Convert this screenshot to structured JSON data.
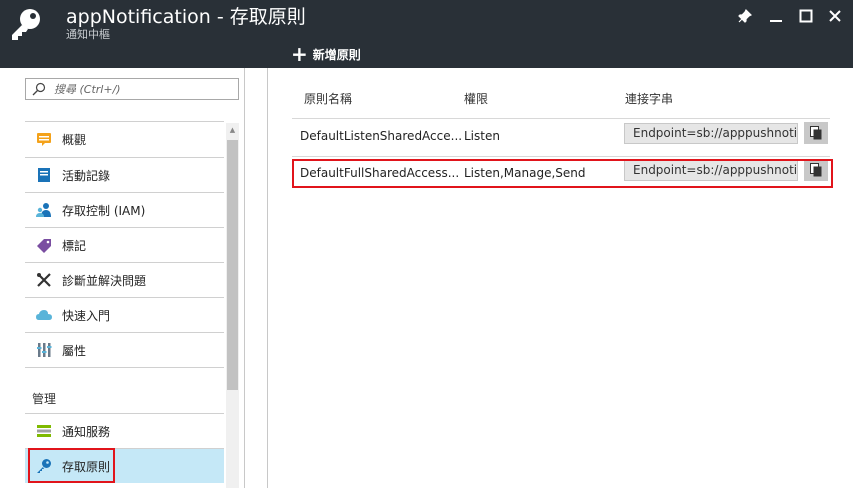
{
  "window": {
    "title": "appNotification - 存取原則",
    "subtitle": "通知中樞"
  },
  "toolbar": {
    "add_label": "新增原則"
  },
  "search": {
    "placeholder": "搜尋 (Ctrl+/)"
  },
  "nav": {
    "items": [
      {
        "label": "概觀",
        "icon": "overview-icon"
      },
      {
        "label": "活動記錄",
        "icon": "activity-log-icon"
      },
      {
        "label": "存取控制 (IAM)",
        "icon": "iam-icon"
      },
      {
        "label": "標記",
        "icon": "tag-icon"
      },
      {
        "label": "診斷並解決問題",
        "icon": "wrench-icon"
      },
      {
        "label": "快速入門",
        "icon": "cloud-icon"
      },
      {
        "label": "屬性",
        "icon": "properties-icon"
      }
    ],
    "section": "管理",
    "manage_items": [
      {
        "label": "通知服務",
        "icon": "notification-services-icon"
      },
      {
        "label": "存取原則",
        "icon": "key-icon",
        "active": true
      }
    ]
  },
  "table": {
    "headers": [
      "原則名稱",
      "權限",
      "連接字串"
    ],
    "rows": [
      {
        "name": "DefaultListenSharedAcce...",
        "permissions": "Listen",
        "connection": "Endpoint=sb://apppushnoti"
      },
      {
        "name": "DefaultFullSharedAccess...",
        "permissions": "Listen,Manage,Send",
        "connection": "Endpoint=sb://apppushnoti"
      }
    ]
  },
  "colors": {
    "header_bg": "#293037",
    "active_bg": "#c5e8f7",
    "highlight": "#e1141b"
  }
}
